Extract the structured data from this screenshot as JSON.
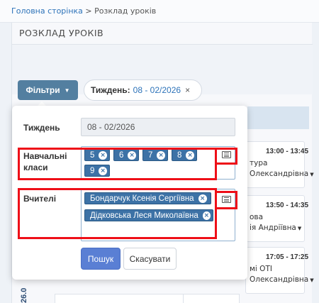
{
  "breadcrumb": {
    "home": "Головна сторінка",
    "separator": ">",
    "current": "Розклад уроків"
  },
  "page": {
    "title": "РОЗКЛАД УРОКІВ"
  },
  "toolbar": {
    "filters_label": "Фільтри",
    "week_chip_label": "Тиждень:",
    "week_chip_value": "08 - 02/2026",
    "chip_close": "×"
  },
  "filter_panel": {
    "week_label": "Тиждень",
    "week_value": "08 - 02/2026",
    "classes_label_line1": "Навчальні",
    "classes_label_line2": "класи",
    "classes": [
      "5",
      "6",
      "7",
      "8",
      "9"
    ],
    "teachers_label": "Вчителі",
    "teachers": [
      "Бондарчук Ксенія Сергіївна",
      "Дідковська Леся Миколаївна"
    ],
    "tag_remove": "×",
    "search_button": "Пошук",
    "cancel_button": "Скасувати"
  },
  "schedule": {
    "side_date": "26.0",
    "lessons": [
      {
        "time": "13:00 - 13:45",
        "subject": "тура",
        "teacher": "Олександрівна"
      },
      {
        "time": "13:50 - 14:35",
        "subject": "ова",
        "teacher": "ія Андріївна"
      },
      {
        "time": "17:05 - 17:25",
        "subject": "мі ОТІ",
        "teacher": "Олександрівна"
      }
    ]
  },
  "colors": {
    "filter_button": "#537fa0",
    "tag": "#3d72a6",
    "search_button": "#5a7fd4",
    "highlight_frame": "#ee0f18",
    "link": "#2d73b9"
  }
}
